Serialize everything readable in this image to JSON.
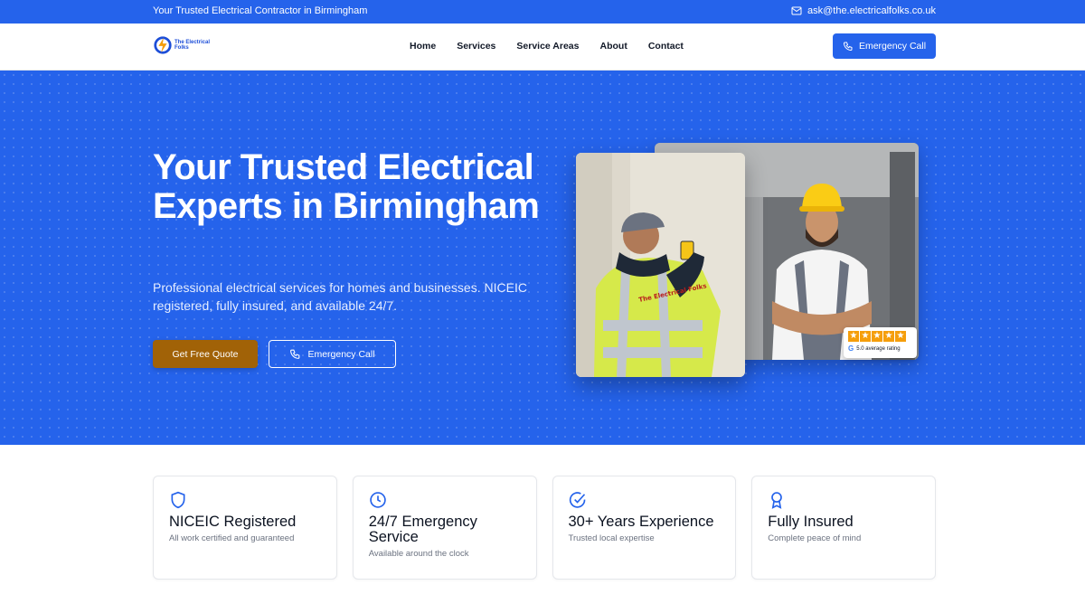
{
  "topbar": {
    "tagline": "Your Trusted Electrical Contractor in Birmingham",
    "email": "ask@the.electricalfolks.co.uk"
  },
  "navbar": {
    "logo_text": "The Electrical Folks",
    "links": [
      "Home",
      "Services",
      "Service Areas",
      "About",
      "Contact"
    ],
    "cta_label": "Emergency Call"
  },
  "hero": {
    "title": "Your Trusted Electrical Experts in Birmingham",
    "lead": "Professional electrical services for homes and businesses. NICEIC registered, fully insured, and available 24/7.",
    "primary_button": "Get Free Quote",
    "secondary_button": "Emergency Call",
    "rating": {
      "stars": 5,
      "label": "5.0 average rating",
      "badge_letter": "G"
    },
    "vest_text": "The Electrical Folks"
  },
  "features": [
    {
      "icon": "shield-icon",
      "title": "NICEIC Registered",
      "text": "All work certified and guaranteed"
    },
    {
      "icon": "clock-icon",
      "title": "24/7 Emergency Service",
      "text": "Available around the clock"
    },
    {
      "icon": "check-circle-icon",
      "title": "30+ Years Experience",
      "text": "Trusted local expertise"
    },
    {
      "icon": "award-icon",
      "title": "Fully Insured",
      "text": "Complete peace of mind"
    }
  ],
  "colors": {
    "primary": "#2563eb",
    "accent": "#a16207",
    "star": "#f59e0b"
  }
}
